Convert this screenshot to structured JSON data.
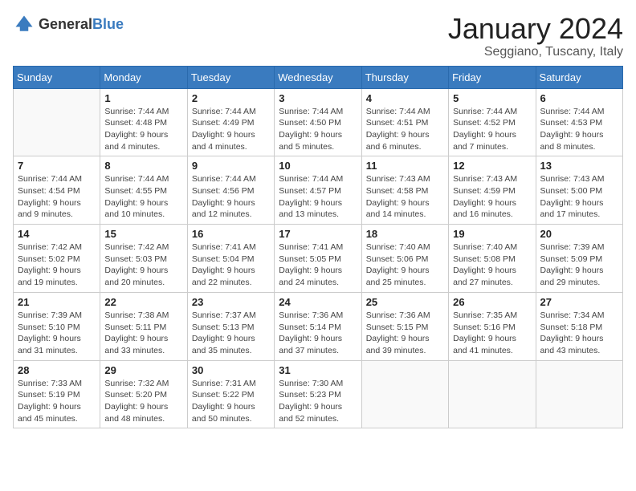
{
  "logo": {
    "text_general": "General",
    "text_blue": "Blue"
  },
  "title": {
    "month": "January 2024",
    "location": "Seggiano, Tuscany, Italy"
  },
  "headers": [
    "Sunday",
    "Monday",
    "Tuesday",
    "Wednesday",
    "Thursday",
    "Friday",
    "Saturday"
  ],
  "weeks": [
    [
      {
        "day": "",
        "sunrise": "",
        "sunset": "",
        "daylight": ""
      },
      {
        "day": "1",
        "sunrise": "Sunrise: 7:44 AM",
        "sunset": "Sunset: 4:48 PM",
        "daylight": "Daylight: 9 hours and 4 minutes."
      },
      {
        "day": "2",
        "sunrise": "Sunrise: 7:44 AM",
        "sunset": "Sunset: 4:49 PM",
        "daylight": "Daylight: 9 hours and 4 minutes."
      },
      {
        "day": "3",
        "sunrise": "Sunrise: 7:44 AM",
        "sunset": "Sunset: 4:50 PM",
        "daylight": "Daylight: 9 hours and 5 minutes."
      },
      {
        "day": "4",
        "sunrise": "Sunrise: 7:44 AM",
        "sunset": "Sunset: 4:51 PM",
        "daylight": "Daylight: 9 hours and 6 minutes."
      },
      {
        "day": "5",
        "sunrise": "Sunrise: 7:44 AM",
        "sunset": "Sunset: 4:52 PM",
        "daylight": "Daylight: 9 hours and 7 minutes."
      },
      {
        "day": "6",
        "sunrise": "Sunrise: 7:44 AM",
        "sunset": "Sunset: 4:53 PM",
        "daylight": "Daylight: 9 hours and 8 minutes."
      }
    ],
    [
      {
        "day": "7",
        "sunrise": "Sunrise: 7:44 AM",
        "sunset": "Sunset: 4:54 PM",
        "daylight": "Daylight: 9 hours and 9 minutes."
      },
      {
        "day": "8",
        "sunrise": "Sunrise: 7:44 AM",
        "sunset": "Sunset: 4:55 PM",
        "daylight": "Daylight: 9 hours and 10 minutes."
      },
      {
        "day": "9",
        "sunrise": "Sunrise: 7:44 AM",
        "sunset": "Sunset: 4:56 PM",
        "daylight": "Daylight: 9 hours and 12 minutes."
      },
      {
        "day": "10",
        "sunrise": "Sunrise: 7:44 AM",
        "sunset": "Sunset: 4:57 PM",
        "daylight": "Daylight: 9 hours and 13 minutes."
      },
      {
        "day": "11",
        "sunrise": "Sunrise: 7:43 AM",
        "sunset": "Sunset: 4:58 PM",
        "daylight": "Daylight: 9 hours and 14 minutes."
      },
      {
        "day": "12",
        "sunrise": "Sunrise: 7:43 AM",
        "sunset": "Sunset: 4:59 PM",
        "daylight": "Daylight: 9 hours and 16 minutes."
      },
      {
        "day": "13",
        "sunrise": "Sunrise: 7:43 AM",
        "sunset": "Sunset: 5:00 PM",
        "daylight": "Daylight: 9 hours and 17 minutes."
      }
    ],
    [
      {
        "day": "14",
        "sunrise": "Sunrise: 7:42 AM",
        "sunset": "Sunset: 5:02 PM",
        "daylight": "Daylight: 9 hours and 19 minutes."
      },
      {
        "day": "15",
        "sunrise": "Sunrise: 7:42 AM",
        "sunset": "Sunset: 5:03 PM",
        "daylight": "Daylight: 9 hours and 20 minutes."
      },
      {
        "day": "16",
        "sunrise": "Sunrise: 7:41 AM",
        "sunset": "Sunset: 5:04 PM",
        "daylight": "Daylight: 9 hours and 22 minutes."
      },
      {
        "day": "17",
        "sunrise": "Sunrise: 7:41 AM",
        "sunset": "Sunset: 5:05 PM",
        "daylight": "Daylight: 9 hours and 24 minutes."
      },
      {
        "day": "18",
        "sunrise": "Sunrise: 7:40 AM",
        "sunset": "Sunset: 5:06 PM",
        "daylight": "Daylight: 9 hours and 25 minutes."
      },
      {
        "day": "19",
        "sunrise": "Sunrise: 7:40 AM",
        "sunset": "Sunset: 5:08 PM",
        "daylight": "Daylight: 9 hours and 27 minutes."
      },
      {
        "day": "20",
        "sunrise": "Sunrise: 7:39 AM",
        "sunset": "Sunset: 5:09 PM",
        "daylight": "Daylight: 9 hours and 29 minutes."
      }
    ],
    [
      {
        "day": "21",
        "sunrise": "Sunrise: 7:39 AM",
        "sunset": "Sunset: 5:10 PM",
        "daylight": "Daylight: 9 hours and 31 minutes."
      },
      {
        "day": "22",
        "sunrise": "Sunrise: 7:38 AM",
        "sunset": "Sunset: 5:11 PM",
        "daylight": "Daylight: 9 hours and 33 minutes."
      },
      {
        "day": "23",
        "sunrise": "Sunrise: 7:37 AM",
        "sunset": "Sunset: 5:13 PM",
        "daylight": "Daylight: 9 hours and 35 minutes."
      },
      {
        "day": "24",
        "sunrise": "Sunrise: 7:36 AM",
        "sunset": "Sunset: 5:14 PM",
        "daylight": "Daylight: 9 hours and 37 minutes."
      },
      {
        "day": "25",
        "sunrise": "Sunrise: 7:36 AM",
        "sunset": "Sunset: 5:15 PM",
        "daylight": "Daylight: 9 hours and 39 minutes."
      },
      {
        "day": "26",
        "sunrise": "Sunrise: 7:35 AM",
        "sunset": "Sunset: 5:16 PM",
        "daylight": "Daylight: 9 hours and 41 minutes."
      },
      {
        "day": "27",
        "sunrise": "Sunrise: 7:34 AM",
        "sunset": "Sunset: 5:18 PM",
        "daylight": "Daylight: 9 hours and 43 minutes."
      }
    ],
    [
      {
        "day": "28",
        "sunrise": "Sunrise: 7:33 AM",
        "sunset": "Sunset: 5:19 PM",
        "daylight": "Daylight: 9 hours and 45 minutes."
      },
      {
        "day": "29",
        "sunrise": "Sunrise: 7:32 AM",
        "sunset": "Sunset: 5:20 PM",
        "daylight": "Daylight: 9 hours and 48 minutes."
      },
      {
        "day": "30",
        "sunrise": "Sunrise: 7:31 AM",
        "sunset": "Sunset: 5:22 PM",
        "daylight": "Daylight: 9 hours and 50 minutes."
      },
      {
        "day": "31",
        "sunrise": "Sunrise: 7:30 AM",
        "sunset": "Sunset: 5:23 PM",
        "daylight": "Daylight: 9 hours and 52 minutes."
      },
      {
        "day": "",
        "sunrise": "",
        "sunset": "",
        "daylight": ""
      },
      {
        "day": "",
        "sunrise": "",
        "sunset": "",
        "daylight": ""
      },
      {
        "day": "",
        "sunrise": "",
        "sunset": "",
        "daylight": ""
      }
    ]
  ]
}
